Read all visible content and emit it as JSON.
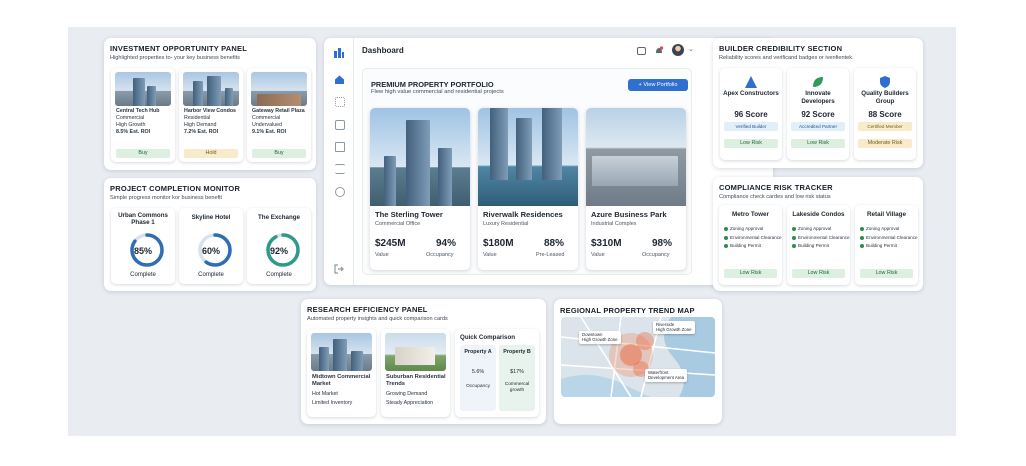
{
  "investment": {
    "title": "INVESTMENT OPPORTUNITY PANEL",
    "subtitle": "Highlighted properties to- your key business benefits",
    "items": [
      {
        "name": "Central Tech Hub",
        "type": "Commercial",
        "note": "High Growth",
        "roi": "8.5% Est. ROI",
        "action": "Buy"
      },
      {
        "name": "Harbor View Condos",
        "type": "Residential",
        "note": "High Demand",
        "roi": "7.2% Est. ROI",
        "action": "Hold"
      },
      {
        "name": "Gateway Retail Plaza",
        "type": "Commercial",
        "note": "Undervalued",
        "roi": "9.1% Est. ROI",
        "action": "Buy"
      }
    ]
  },
  "completion": {
    "title": "PROJECT COMPLETION MONITOR",
    "subtitle": "Simple progress monitor kor business benefit",
    "items": [
      {
        "name": "Urban Commons Phase 1",
        "percent_label": "85%",
        "percent": 85,
        "status": "Complete"
      },
      {
        "name": "Skyline Hotel",
        "percent_label": "60%",
        "percent": 60,
        "status": "Complete"
      },
      {
        "name": "The Exchange",
        "percent_label": "92%",
        "percent": 92,
        "status": "Complete"
      }
    ],
    "colors": {
      "ring": "#2f6db5",
      "ring_last": "#2f9a8a",
      "track": "#d9e2ec"
    }
  },
  "dashboard": {
    "title": "Dashboard",
    "panel_title": "PREMIUM PROPERTY PORTFOLIO",
    "panel_subtitle": "Flew high value commercial and residential projects",
    "view_button": "+ View Portfolio",
    "properties": [
      {
        "name": "The Sterling Tower",
        "type": "Commercial Office",
        "value": "$245M",
        "value_label": "Value",
        "metric": "94%",
        "metric_label": "Occupancy"
      },
      {
        "name": "Riverwalk Residences",
        "type": "Luxury Residential",
        "value": "$180M",
        "value_label": "Value",
        "metric": "88%",
        "metric_label": "Pre-Leased"
      },
      {
        "name": "Azure Business Park",
        "type": "Industrial Complex",
        "value": "$310M",
        "value_label": "Value",
        "metric": "98%",
        "metric_label": "Occupancy"
      }
    ],
    "accent": "#2f6fcf"
  },
  "builder": {
    "title": "BUILDER CREDIBILITY SECTION",
    "subtitle": "Reliability scores and verificand badges or ivenfientek.",
    "items": [
      {
        "name": "Apex Constructors",
        "score": "96 Score",
        "badge": "Verified Builder",
        "risk": "Low Risk",
        "icon": "triangle-logo-icon"
      },
      {
        "name": "Innovate Developers",
        "score": "92 Score",
        "badge": "Accredited Partner",
        "risk": "Low Risk",
        "icon": "leaf-logo-icon"
      },
      {
        "name": "Quality Builders Group",
        "score": "88 Score",
        "badge": "Certified Member",
        "risk": "Moderate Risk",
        "icon": "shield-logo-icon"
      }
    ]
  },
  "compliance": {
    "title": "COMPLIANCE RISK TRACKER",
    "subtitle": "Compliance check cardes and low risk status",
    "items": [
      {
        "name": "Metro Tower",
        "checks": [
          "Zoning Approval",
          "Environmental Clearance",
          "Building Permit"
        ],
        "risk": "Low Risk"
      },
      {
        "name": "Lakeside Condos",
        "checks": [
          "Zoning Approval",
          "Environmental Clearance",
          "Building Permit"
        ],
        "risk": "Low Risk"
      },
      {
        "name": "Retail Village",
        "checks": [
          "Zoning Approval",
          "Environmental Clearance",
          "Building Permit"
        ],
        "risk": "Low Risk"
      }
    ]
  },
  "research": {
    "title": "RESEARCH EFFICIENCY PANEL",
    "subtitle": "Automated property insights and quick comparison cards",
    "cards": [
      {
        "name": "Midtown Commercial Market",
        "line1": "Hot Market",
        "line2": "Limited Inventory"
      },
      {
        "name": "Suburban Residential Trends",
        "line1": "Growing Demand",
        "line2": "Steady Appreciation"
      }
    ],
    "comparison": {
      "title": "Quick Comparison",
      "col_a": "Property A",
      "col_b": "Property B",
      "val_a": "5.6%",
      "val_b": "$17%",
      "lab_a": "Occupancy",
      "lab_b": "Commercal growth"
    }
  },
  "map": {
    "title": "REGIONAL PROPERTY TREND MAP",
    "labels": [
      {
        "line1": "Downtown",
        "line2": "High Growth Zone"
      },
      {
        "line1": "Riverside",
        "line2": "High Growth Zone"
      },
      {
        "line1": "Waterfront",
        "line2": "Development Area"
      }
    ]
  }
}
